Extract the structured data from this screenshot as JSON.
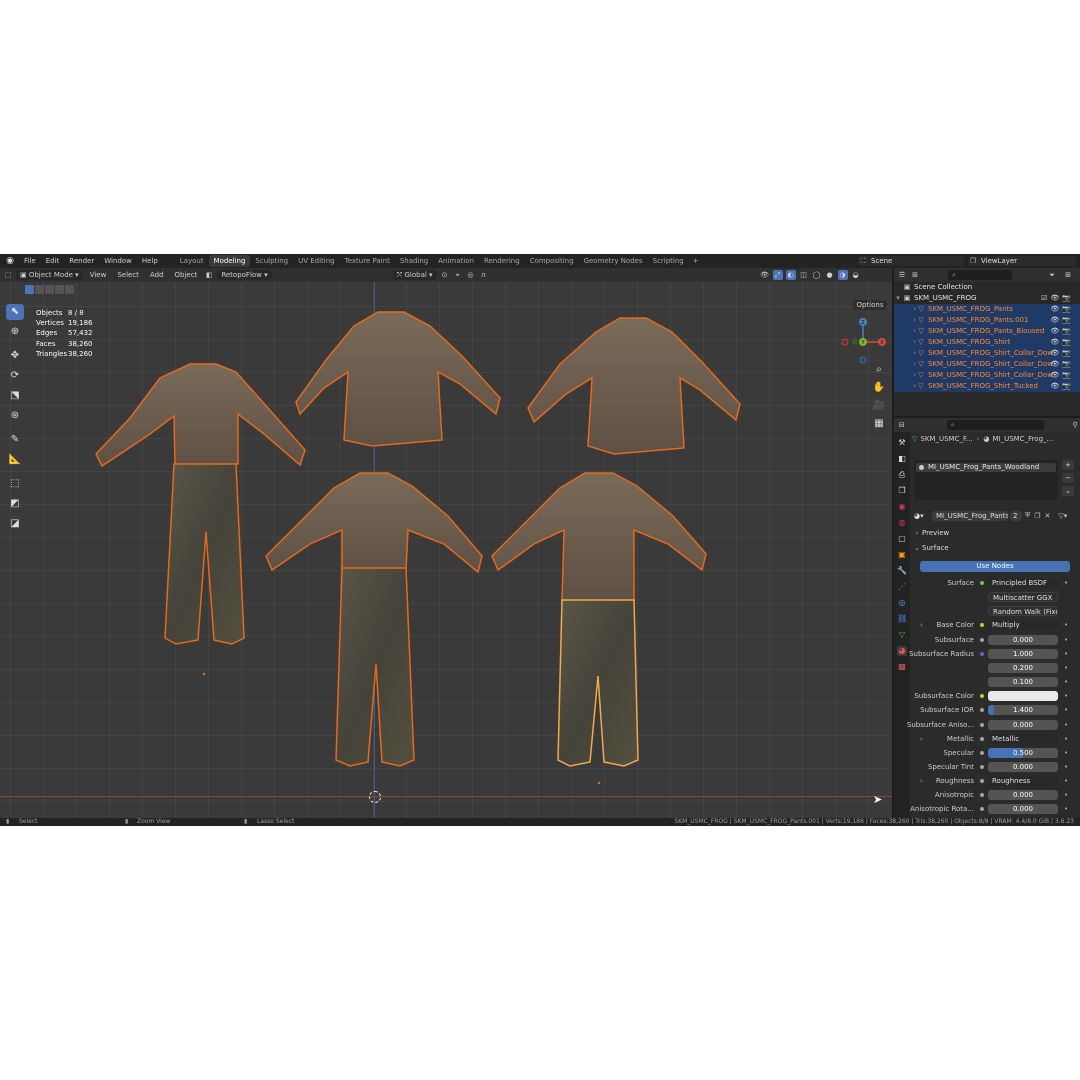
{
  "menu": [
    "File",
    "Edit",
    "Render",
    "Window",
    "Help"
  ],
  "workspaces": [
    {
      "label": "Layout",
      "active": false
    },
    {
      "label": "Modeling",
      "active": true
    },
    {
      "label": "Sculpting",
      "active": false
    },
    {
      "label": "UV Editing",
      "active": false
    },
    {
      "label": "Texture Paint",
      "active": false
    },
    {
      "label": "Shading",
      "active": false
    },
    {
      "label": "Animation",
      "active": false
    },
    {
      "label": "Rendering",
      "active": false
    },
    {
      "label": "Compositing",
      "active": false
    },
    {
      "label": "Geometry Nodes",
      "active": false
    },
    {
      "label": "Scripting",
      "active": false
    }
  ],
  "add_tab": "+",
  "scene": "Scene",
  "view_layer": "ViewLayer",
  "viewport_header": {
    "mode": "Object Mode",
    "items": [
      "View",
      "Select",
      "Add",
      "Object"
    ],
    "addon": "RetopoFlow",
    "orientation": "Global",
    "options": "Options"
  },
  "stats": [
    {
      "label": "Objects",
      "value": "8 / 8"
    },
    {
      "label": "Vertices",
      "value": "19,186"
    },
    {
      "label": "Edges",
      "value": "57,432"
    },
    {
      "label": "Faces",
      "value": "38,260"
    },
    {
      "label": "Triangles",
      "value": "38,260"
    }
  ],
  "gizmo": {
    "x": "X",
    "y": "Y",
    "z": "Z"
  },
  "outliner": {
    "collection_header": "Scene Collection",
    "root": "SKM_USMC_FROG",
    "rows": [
      {
        "name": "SKM_USMC_FROG_Pants",
        "selected": true
      },
      {
        "name": "SKM_USMC_FROG_Pants.001",
        "selected": true,
        "active": true
      },
      {
        "name": "SKM_USMC_FROG_Pants_Bloused",
        "selected": true
      },
      {
        "name": "SKM_USMC_FROG_Shirt",
        "selected": true
      },
      {
        "name": "SKM_USMC_FROG_Shirt_Collar_Dow",
        "selected": true
      },
      {
        "name": "SKM_USMC_FROG_Shirt_Collar_Dow",
        "selected": true
      },
      {
        "name": "SKM_USMC_FROG_Shirt_Collar_Dow",
        "selected": true
      },
      {
        "name": "SKM_USMC_FROG_Shirt_Tucked",
        "selected": true
      }
    ]
  },
  "properties": {
    "breadcrumb_object": "SKM_USMC_F...",
    "breadcrumb_material": "MI_USMC_Frog_...",
    "material_slot": "MI_USMC_Frog_Pants_Woodland",
    "material_name": "MI_USMC_Frog_Pants...",
    "material_users": "2",
    "panel_preview": "Preview",
    "panel_surface": "Surface",
    "use_nodes": "Use Nodes",
    "rows": [
      {
        "label": "Surface",
        "kind": "link",
        "value": "Principled BSDF",
        "dot": "#6fbf5f"
      },
      {
        "label": "",
        "kind": "dropdown",
        "value": "Multiscatter GGX"
      },
      {
        "label": "",
        "kind": "dropdown",
        "value": "Random Walk (Fixed R..."
      },
      {
        "label": "Base Color",
        "kind": "link",
        "value": "Multiply",
        "dot": "#c7c729",
        "expand": true
      },
      {
        "label": "Subsurface",
        "kind": "number",
        "value": "0.000",
        "dot": "#a1a1a1"
      },
      {
        "label": "Subsurface Radius",
        "kind": "number",
        "value": "1.000",
        "dot": "#6363c7"
      },
      {
        "label": "",
        "kind": "number",
        "value": "0.200"
      },
      {
        "label": "",
        "kind": "number",
        "value": "0.100"
      },
      {
        "label": "Subsurface Color",
        "kind": "color",
        "value": "",
        "dot": "#c7c729",
        "color": "#e8e8e8"
      },
      {
        "label": "Subsurface IOR",
        "kind": "number",
        "value": "1.400",
        "dot": "#a1a1a1",
        "fill": 0.08
      },
      {
        "label": "Subsurface Aniso...",
        "kind": "number",
        "value": "0.000",
        "dot": "#a1a1a1"
      },
      {
        "label": "Metallic",
        "kind": "link",
        "value": "Metallic",
        "dot": "#a1a1a1",
        "expand": true
      },
      {
        "label": "Specular",
        "kind": "number",
        "value": "0.500",
        "dot": "#a1a1a1",
        "fill": 0.5
      },
      {
        "label": "Specular Tint",
        "kind": "number",
        "value": "0.000",
        "dot": "#a1a1a1"
      },
      {
        "label": "Roughness",
        "kind": "link",
        "value": "Roughness",
        "dot": "#a1a1a1",
        "expand": true
      },
      {
        "label": "Anisotropic",
        "kind": "number",
        "value": "0.000",
        "dot": "#a1a1a1"
      },
      {
        "label": "Anisotropic Rota...",
        "kind": "number",
        "value": "0.000",
        "dot": "#a1a1a1"
      }
    ]
  },
  "statusbar": {
    "select": "Select",
    "zoom": "Zoom View",
    "lasso": "Lasso Select",
    "info": "SKM_USMC_FROG | SKM_USMC_FROG_Pants.001 | Verts:19,186 | Faces:38,260 | Tris:38,260 | Objects:8/8 | VRAM: 4.4/8.0 GiB | 3.6.23"
  }
}
